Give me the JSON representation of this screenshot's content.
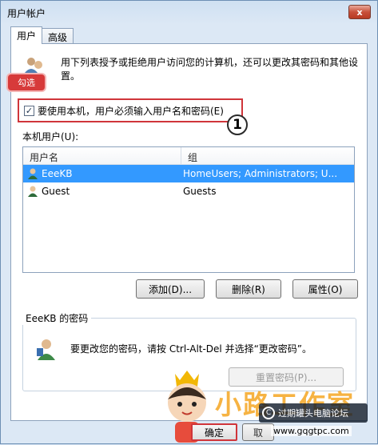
{
  "window": {
    "title": "用户帐户",
    "close_label": "x"
  },
  "tabs": [
    {
      "label": "用户"
    },
    {
      "label": "高级"
    }
  ],
  "intro_text": "用下列表授予或拒绝用户访问您的计算机，还可以更改其密码和其他设置。",
  "callout_label": "勾选",
  "require_password_checkbox": {
    "checked": true,
    "check_mark": "✓",
    "label": "要使用本机，用户必须输入用户名和密码(E)"
  },
  "step_badge": "1",
  "local_users": {
    "label": "本机用户(U):",
    "columns": [
      "用户名",
      "组"
    ],
    "rows": [
      {
        "name": "EeeKB",
        "group": "HomeUsers; Administrators; U...",
        "selected": true
      },
      {
        "name": "Guest",
        "group": "Guests",
        "selected": false
      }
    ]
  },
  "buttons": {
    "add": "添加(D)...",
    "remove": "删除(R)",
    "properties": "属性(O)"
  },
  "password_group": {
    "title": "EeeKB 的密码",
    "instruction": "要更改您的密码，请按 Ctrl-Alt-Del 并选择“更改密码”。",
    "reset_button": "重置密码(P)..."
  },
  "footer": {
    "ok": "确定",
    "cancel_partial": "取"
  },
  "watermark": {
    "title": "小路工作室",
    "badge": "过期罐头电脑论坛",
    "site": "www.gqgtpc.com",
    "badge_icon": "C"
  },
  "colors": {
    "selection": "#3399ff",
    "highlight_red": "#d0353a",
    "watermark_orange": "#f5a623"
  }
}
